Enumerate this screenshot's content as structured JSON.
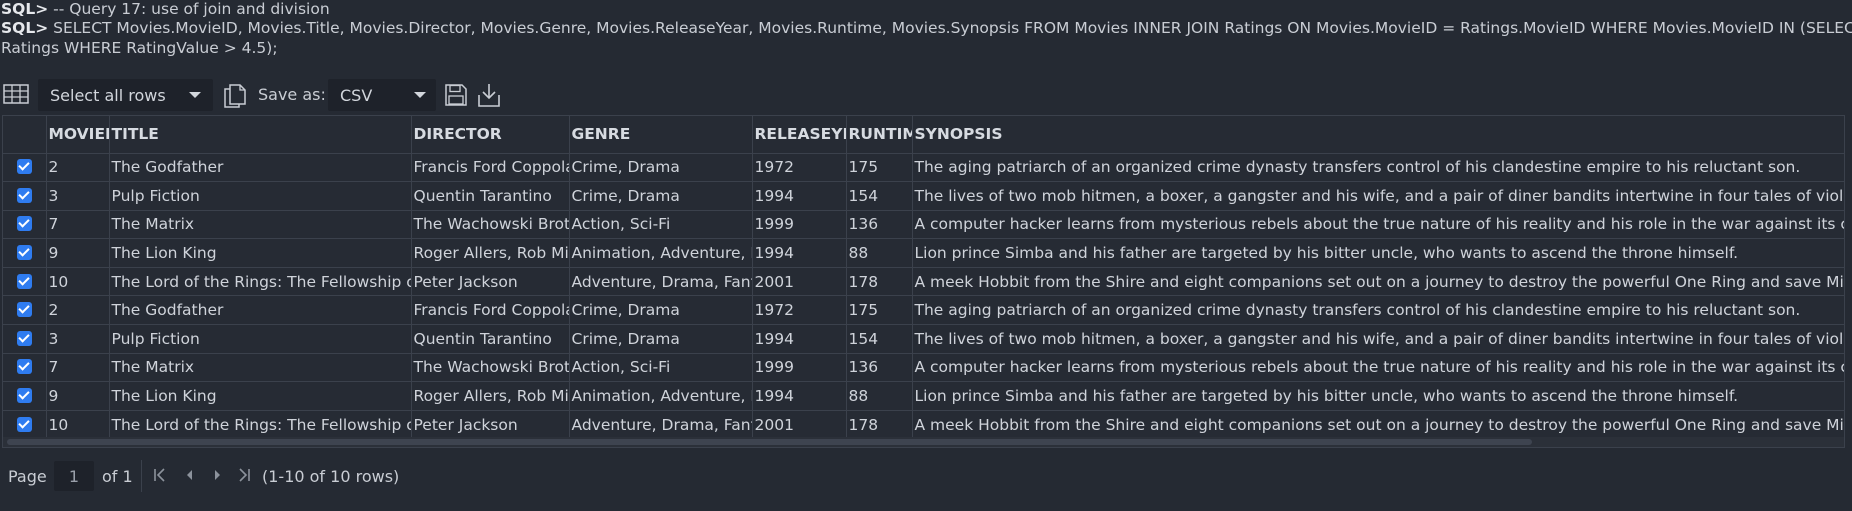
{
  "console": {
    "prompt": "SQL>",
    "comment": "-- Query 17: use of join and division",
    "query_line1": "SELECT Movies.MovieID, Movies.Title, Movies.Director, Movies.Genre, Movies.ReleaseYear, Movies.Runtime, Movies.Synopsis FROM Movies INNER JOIN Ratings ON Movies.MovieID = Ratings.MovieID WHERE Movies.MovieID IN (SELECT MovieID FROM",
    "query_line2": "Ratings WHERE RatingValue > 4.5);"
  },
  "toolbar": {
    "grid_icon": "table-grid-icon",
    "row_select": "Select all rows",
    "copy_icon": "copy-icon",
    "save_as_label": "Save as:",
    "format": "CSV",
    "save_icon": "floppy-save-icon",
    "download_icon": "download-icon"
  },
  "table": {
    "columns": [
      "MOVIEID",
      "TITLE",
      "DIRECTOR",
      "GENRE",
      "RELEASEYEAR",
      "RUNTIME",
      "SYNOPSIS"
    ],
    "rows": [
      [
        "2",
        "The Godfather",
        "Francis Ford Coppola",
        "Crime, Drama",
        "1972",
        "175",
        "The aging patriarch of an organized crime dynasty transfers control of his clandestine empire to his reluctant son."
      ],
      [
        "3",
        "Pulp Fiction",
        "Quentin Tarantino",
        "Crime, Drama",
        "1994",
        "154",
        "The lives of two mob hitmen, a boxer, a gangster and his wife, and a pair of diner bandits intertwine in four tales of violence and redemption."
      ],
      [
        "7",
        "The Matrix",
        "The Wachowski Brothers",
        "Action, Sci-Fi",
        "1999",
        "136",
        "A computer hacker learns from mysterious rebels about the true nature of his reality and his role in the war against its controllers."
      ],
      [
        "9",
        "The Lion King",
        "Roger Allers, Rob Minkoff",
        "Animation, Adventure, Drama",
        "1994",
        "88",
        "Lion prince Simba and his father are targeted by his bitter uncle, who wants to ascend the throne himself."
      ],
      [
        "10",
        "The Lord of the Rings: The Fellowship of the Ring",
        "Peter Jackson",
        "Adventure, Drama, Fantasy",
        "2001",
        "178",
        "A meek Hobbit from the Shire and eight companions set out on a journey to destroy the powerful One Ring and save Middle-earth."
      ],
      [
        "2",
        "The Godfather",
        "Francis Ford Coppola",
        "Crime, Drama",
        "1972",
        "175",
        "The aging patriarch of an organized crime dynasty transfers control of his clandestine empire to his reluctant son."
      ],
      [
        "3",
        "Pulp Fiction",
        "Quentin Tarantino",
        "Crime, Drama",
        "1994",
        "154",
        "The lives of two mob hitmen, a boxer, a gangster and his wife, and a pair of diner bandits intertwine in four tales of violence and redemption."
      ],
      [
        "7",
        "The Matrix",
        "The Wachowski Brothers",
        "Action, Sci-Fi",
        "1999",
        "136",
        "A computer hacker learns from mysterious rebels about the true nature of his reality and his role in the war against its controllers."
      ],
      [
        "9",
        "The Lion King",
        "Roger Allers, Rob Minkoff",
        "Animation, Adventure, Drama",
        "1994",
        "88",
        "Lion prince Simba and his father are targeted by his bitter uncle, who wants to ascend the throne himself."
      ],
      [
        "10",
        "The Lord of the Rings: The Fellowship of the Ring",
        "Peter Jackson",
        "Adventure, Drama, Fantasy",
        "2001",
        "178",
        "A meek Hobbit from the Shire and eight companions set out on a journey to destroy the powerful One Ring and save Middle-earth."
      ]
    ],
    "checkbox_color": "#2f7cf0"
  },
  "pager": {
    "page_label": "Page",
    "page_value": "1",
    "of_label": "of 1",
    "rows_info": "(1-10 of 10 rows)",
    "first_icon": "first-page-icon",
    "prev_icon": "prev-page-icon",
    "next_icon": "next-page-icon",
    "last_icon": "last-page-icon"
  }
}
